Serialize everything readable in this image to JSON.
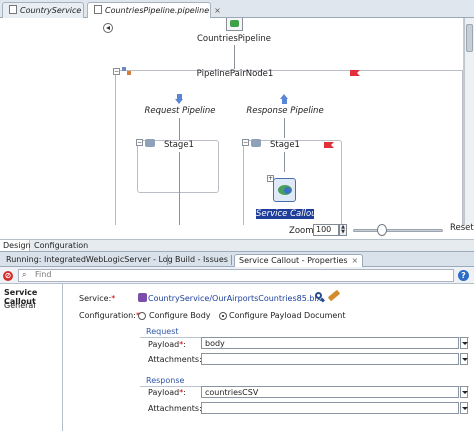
{
  "editor_tabs": [
    {
      "label": "CountryService",
      "active": false
    },
    {
      "label": "CountriesPipeline.pipeline",
      "active": true
    }
  ],
  "canvas": {
    "pipeline_name": "CountriesPipeline",
    "pair_node": "PipelinePairNode1",
    "request_pipeline": "Request Pipeline",
    "response_pipeline": "Response Pipeline",
    "stage_left": "Stage1",
    "stage_right": "Stage1",
    "service_callout": "Service Callout"
  },
  "zoom": {
    "label": "Zoom:",
    "value": "100",
    "reset": "Reset"
  },
  "view_tabs": [
    {
      "label": "Design",
      "active": true
    },
    {
      "label": "Configuration",
      "active": false
    }
  ],
  "log_tabs": [
    {
      "label": "Running: IntegratedWebLogicServer - Log"
    },
    {
      "label": "Build - Issues"
    },
    {
      "label": "Service Callout - Properties"
    }
  ],
  "find": {
    "placeholder": "Find"
  },
  "left_nav": [
    "Service Callout",
    "General"
  ],
  "properties": {
    "service_label": "Service:",
    "service_value": "CountryService/OurAirportsCountries85.bix",
    "configuration_label": "Configuration:",
    "option_body": "Configure Body",
    "option_payload": "Configure Payload Document",
    "selected_option": "Configure Payload Document",
    "request_title": "Request",
    "response_title": "Response",
    "payload_label": "Payload",
    "attachments_label": "Attachments:",
    "request_payload": "body",
    "request_attachments": "",
    "response_payload": "countriesCSV",
    "response_attachments": ""
  },
  "colors": {
    "accent": "#2c56a6",
    "flag": "#e0303a",
    "selection_bg": "#1f3e9a"
  }
}
